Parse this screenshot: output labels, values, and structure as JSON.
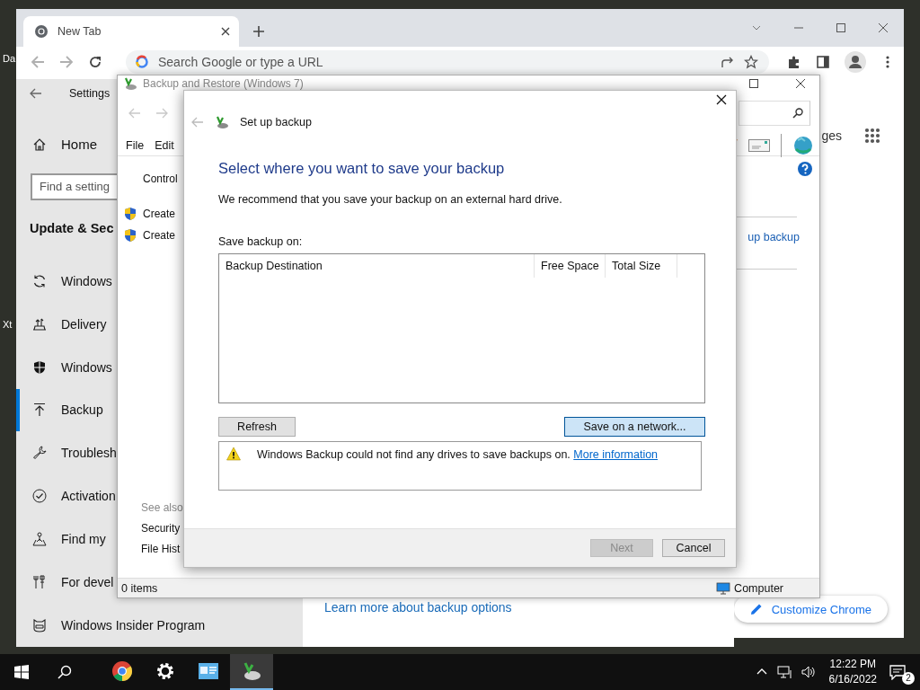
{
  "desktop": {
    "icon_labels": [
      "Da",
      "Xt"
    ]
  },
  "chrome": {
    "tab": {
      "title": "New Tab",
      "selected": true
    },
    "omnibox": {
      "placeholder": "Search Google or type a URL"
    },
    "header_link": "ges",
    "customize_button": "Customize Chrome"
  },
  "settings": {
    "title": "Settings",
    "home": "Home",
    "search": {
      "placeholder": "Find a setting"
    },
    "section": "Update & Sec",
    "nav": [
      {
        "label": "Windows",
        "kind": "sync",
        "selected": false
      },
      {
        "label": "Delivery",
        "kind": "delivery",
        "selected": false
      },
      {
        "label": "Windows",
        "kind": "shield",
        "selected": false
      },
      {
        "label": "Backup",
        "kind": "backup",
        "selected": true
      },
      {
        "label": "Troublesh",
        "kind": "wrench",
        "selected": false
      },
      {
        "label": "Activation",
        "kind": "check",
        "selected": false
      },
      {
        "label": "Find my",
        "kind": "locate",
        "selected": false
      },
      {
        "label": "For devel",
        "kind": "tools",
        "selected": false
      },
      {
        "label": "Windows Insider Program",
        "kind": "insider",
        "selected": false
      }
    ],
    "content_link": "Learn more about backup options"
  },
  "control_panel": {
    "title": "Backup and Restore (Windows 7)",
    "menu": [
      "File",
      "Edit"
    ],
    "breadcrumb": "Control",
    "tasks": [
      "Create",
      "Create"
    ],
    "side_link": "up backup",
    "see_also": {
      "heading": "See also",
      "links": [
        "Security",
        "File Hist"
      ]
    },
    "status": {
      "items": "0 items",
      "location": "Computer"
    }
  },
  "dialog": {
    "title": "Set up backup",
    "heading": "Select where you want to save your backup",
    "intro": "We recommend that you save your backup on an external hard drive.",
    "list_label": "Save backup on:",
    "columns": [
      "Backup Destination",
      "Free Space",
      "Total Size"
    ],
    "actions": [
      {
        "label": "Refresh",
        "focused": false
      },
      {
        "label": "Save on a network...",
        "focused": true
      }
    ],
    "message": {
      "text": "Windows Backup could not find any drives to save backups on.",
      "link": "More information"
    },
    "footer": [
      {
        "label": "Next",
        "disabled": true
      },
      {
        "label": "Cancel",
        "disabled": false
      }
    ]
  },
  "taskbar": {
    "apps": [
      {
        "kind": "chrome",
        "active": false
      },
      {
        "kind": "settings",
        "active": false
      },
      {
        "kind": "control-panel",
        "active": false
      },
      {
        "kind": "backup",
        "active": true
      }
    ],
    "time": "12:22 PM",
    "date": "6/16/2022",
    "notifications": "2"
  }
}
